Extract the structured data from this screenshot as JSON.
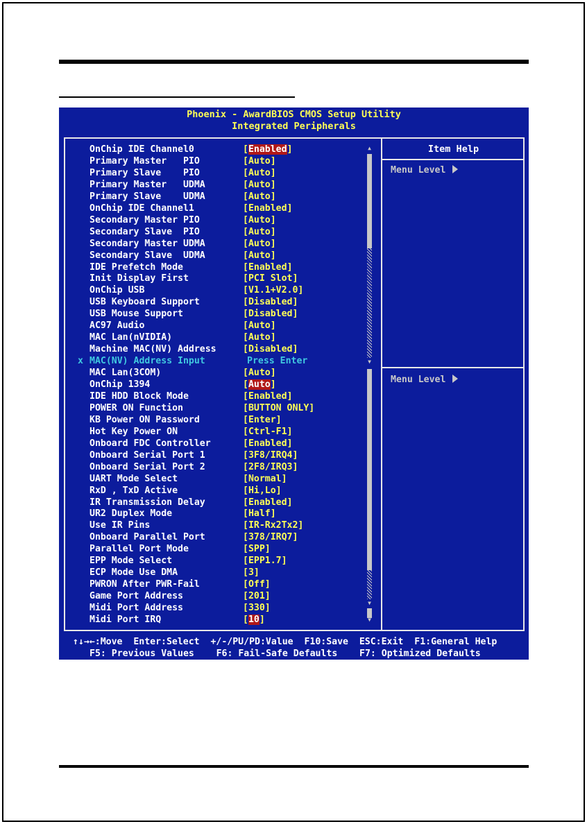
{
  "bios": {
    "title": "Phoenix - AwardBIOS CMOS Setup Utility",
    "subtitle": "Integrated Peripherals",
    "help_header": "Item Help",
    "menu_level_label": "Menu Level",
    "footer_line1": "↑↓→←:Move  Enter:Select  +/-/PU/PD:Value  F10:Save  ESC:Exit  F1:General Help",
    "footer_line2": "F5: Previous Values    F6: Fail-Safe Defaults    F7: Optimized Defaults"
  },
  "settings": [
    {
      "label": "OnChip IDE Channel0",
      "value": "Enabled",
      "highlighted": true
    },
    {
      "label": "Primary Master   PIO",
      "value": "Auto"
    },
    {
      "label": "Primary Slave    PIO",
      "value": "Auto"
    },
    {
      "label": "Primary Master   UDMA",
      "value": "Auto"
    },
    {
      "label": "Primary Slave    UDMA",
      "value": "Auto"
    },
    {
      "label": "OnChip IDE Channel1",
      "value": "Enabled"
    },
    {
      "label": "Secondary Master PIO",
      "value": "Auto"
    },
    {
      "label": "Secondary Slave  PIO",
      "value": "Auto"
    },
    {
      "label": "Secondary Master UDMA",
      "value": "Auto"
    },
    {
      "label": "Secondary Slave  UDMA",
      "value": "Auto"
    },
    {
      "label": "IDE Prefetch Mode",
      "value": "Enabled"
    },
    {
      "label": "Init Display First",
      "value": "PCI Slot"
    },
    {
      "label": "OnChip USB",
      "value": "V1.1+V2.0"
    },
    {
      "label": "USB Keyboard Support",
      "value": "Disabled"
    },
    {
      "label": "USB Mouse Support",
      "value": "Disabled"
    },
    {
      "label": "AC97 Audio",
      "value": "Auto"
    },
    {
      "label": "MAC Lan(nVIDIA)",
      "value": "Auto"
    },
    {
      "label": "Machine MAC(NV) Address",
      "value": "Disabled"
    },
    {
      "label": "MAC(NV) Address Input",
      "value": "Press Enter",
      "disabled": true,
      "mark": "x"
    },
    {
      "label": "MAC Lan(3COM)",
      "value": "Auto"
    },
    {
      "label": "OnChip 1394",
      "value": "Auto",
      "highlighted": true
    },
    {
      "label": "IDE HDD Block Mode",
      "value": "Enabled"
    },
    {
      "label": "POWER ON Function",
      "value": "BUTTON ONLY"
    },
    {
      "label": "KB Power ON Password",
      "value": "Enter"
    },
    {
      "label": "Hot Key Power ON",
      "value": "Ctrl-F1"
    },
    {
      "label": "Onboard FDC Controller",
      "value": "Enabled"
    },
    {
      "label": "Onboard Serial Port 1",
      "value": "3F8/IRQ4"
    },
    {
      "label": "Onboard Serial Port 2",
      "value": "2F8/IRQ3"
    },
    {
      "label": "UART Mode Select",
      "value": "Normal"
    },
    {
      "label": "RxD , TxD Active",
      "value": "Hi,Lo"
    },
    {
      "label": "IR Transmission Delay",
      "value": "Enabled"
    },
    {
      "label": "UR2 Duplex Mode",
      "value": "Half"
    },
    {
      "label": "Use IR Pins",
      "value": "IR-Rx2Tx2"
    },
    {
      "label": "Onboard Parallel Port",
      "value": "378/IRQ7"
    },
    {
      "label": "Parallel Port Mode",
      "value": "SPP"
    },
    {
      "label": "EPP Mode Select",
      "value": "EPP1.7"
    },
    {
      "label": "ECP Mode Use DMA",
      "value": "3"
    },
    {
      "label": "PWRON After PWR-Fail",
      "value": "Off"
    },
    {
      "label": "Game Port Address",
      "value": "201"
    },
    {
      "label": "Midi Port Address",
      "value": "330"
    },
    {
      "label": "Midi Port IRQ",
      "value": "10",
      "highlighted": true
    }
  ]
}
